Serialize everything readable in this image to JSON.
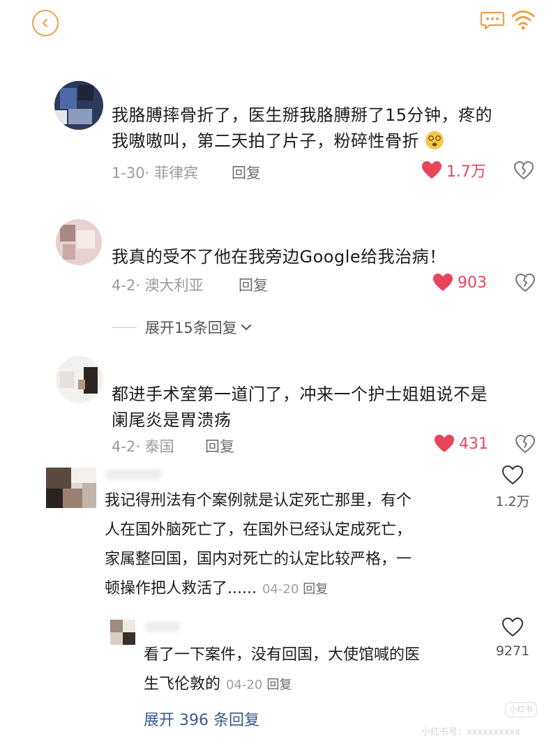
{
  "header": {
    "back_icon": "chevron-left-icon",
    "chat_icon": "chat-bubble-icon",
    "wifi_icon": "wifi-icon",
    "accent_color": "#E9A24A"
  },
  "comments": [
    {
      "text_line1": "我胳膊摔骨折了，医生掰我胳膊掰了15分钟，疼的",
      "text_line2": "我嗷嗷叫，第二天拍了片子，粉碎性骨折",
      "emoji": "dizzy-face-emoji",
      "date_location": "1-30· 菲律宾",
      "reply_label": "回复",
      "likes": "1.7万"
    },
    {
      "text_line1": "我真的受不了他在我旁边Google给我治病！",
      "date_location": "4-2· 澳大利亚",
      "reply_label": "回复",
      "likes": "903",
      "expand_label": "展开15条回复"
    },
    {
      "text_line1": "都进手术室第一道门了，冲来一个护士姐姐说不是",
      "text_line2": "阑尾炎是胃溃疡",
      "date_location": "4-2· 泰国",
      "reply_label": "回复",
      "likes": "431"
    }
  ],
  "thread": {
    "main": {
      "line1": "我记得刑法有个案例就是认定死亡那里，有个",
      "line2": "人在国外脑死亡了，在国外已经认定成死亡，",
      "line3": "家属整回国，国内对死亡的认定比较严格，一",
      "line4": "顿操作把人救活了......",
      "date": "04-20",
      "reply_label": "回复",
      "likes": "1.2万"
    },
    "sub": {
      "line1": "看了一下案件，没有回国，大使馆喊的医",
      "line2": "生飞伦敦的",
      "date": "04-20",
      "reply_label": "回复",
      "likes": "9271"
    },
    "more_replies": "展开 396 条回复"
  },
  "watermark": {
    "badge": "小红书",
    "text": "小红书号：xxxxxxxxxx"
  }
}
